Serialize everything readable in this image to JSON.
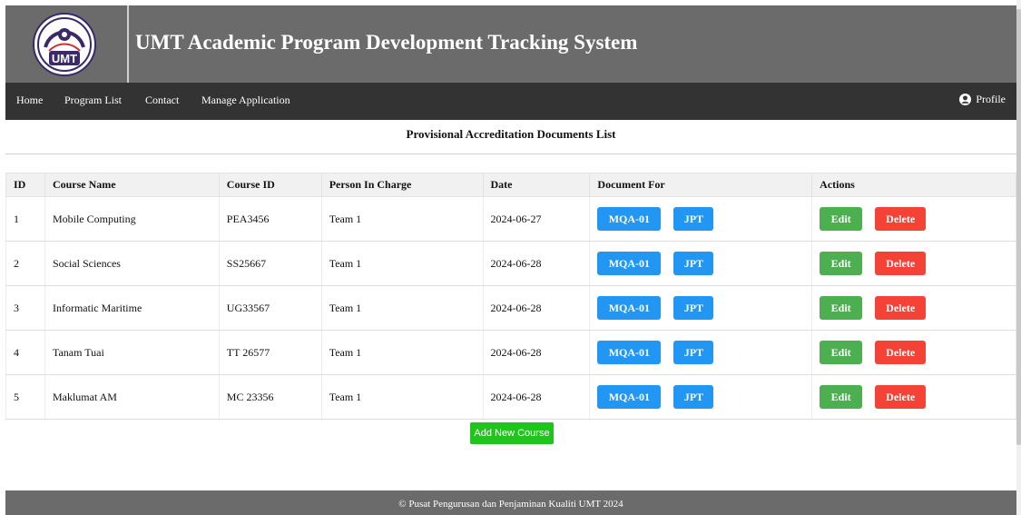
{
  "header": {
    "title": "UMT Academic Program Development Tracking System",
    "logo_text": "UMT"
  },
  "nav": {
    "items": [
      {
        "label": "Home"
      },
      {
        "label": "Program List"
      },
      {
        "label": "Contact"
      },
      {
        "label": "Manage Application"
      }
    ],
    "profile_label": "Profile",
    "profile_icon": "user-circle-icon"
  },
  "main": {
    "title": "Provisional Accreditation Documents List",
    "columns": [
      "ID",
      "Course Name",
      "Course ID",
      "Person In Charge",
      "Date",
      "Document For",
      "Actions"
    ],
    "rows": [
      {
        "id": "1",
        "course_name": "Mobile Computing",
        "course_id": "PEA3456",
        "person": "Team 1",
        "date": "2024-06-27"
      },
      {
        "id": "2",
        "course_name": "Social Sciences",
        "course_id": "SS25667",
        "person": "Team 1",
        "date": "2024-06-28"
      },
      {
        "id": "3",
        "course_name": "Informatic Maritime",
        "course_id": "UG33567",
        "person": "Team 1",
        "date": "2024-06-28"
      },
      {
        "id": "4",
        "course_name": "Tanam Tuai",
        "course_id": "TT 26577",
        "person": "Team 1",
        "date": "2024-06-28"
      },
      {
        "id": "5",
        "course_name": "Maklumat AM",
        "course_id": "MC 23356",
        "person": "Team 1",
        "date": "2024-06-28"
      }
    ],
    "doc_buttons": {
      "mqa": "MQA-01",
      "jpt": "JPT"
    },
    "action_buttons": {
      "edit": "Edit",
      "delete": "Delete"
    },
    "add_button": "Add New Course"
  },
  "footer": {
    "text": "© Pusat Pengurusan dan Penjaminan Kualiti UMT 2024"
  },
  "colors": {
    "banner": "#6b6b6b",
    "navbar": "#333333",
    "doc_button": "#2196f3",
    "edit_button": "#4caf50",
    "delete_button": "#f44336",
    "add_button": "#22c31e"
  }
}
